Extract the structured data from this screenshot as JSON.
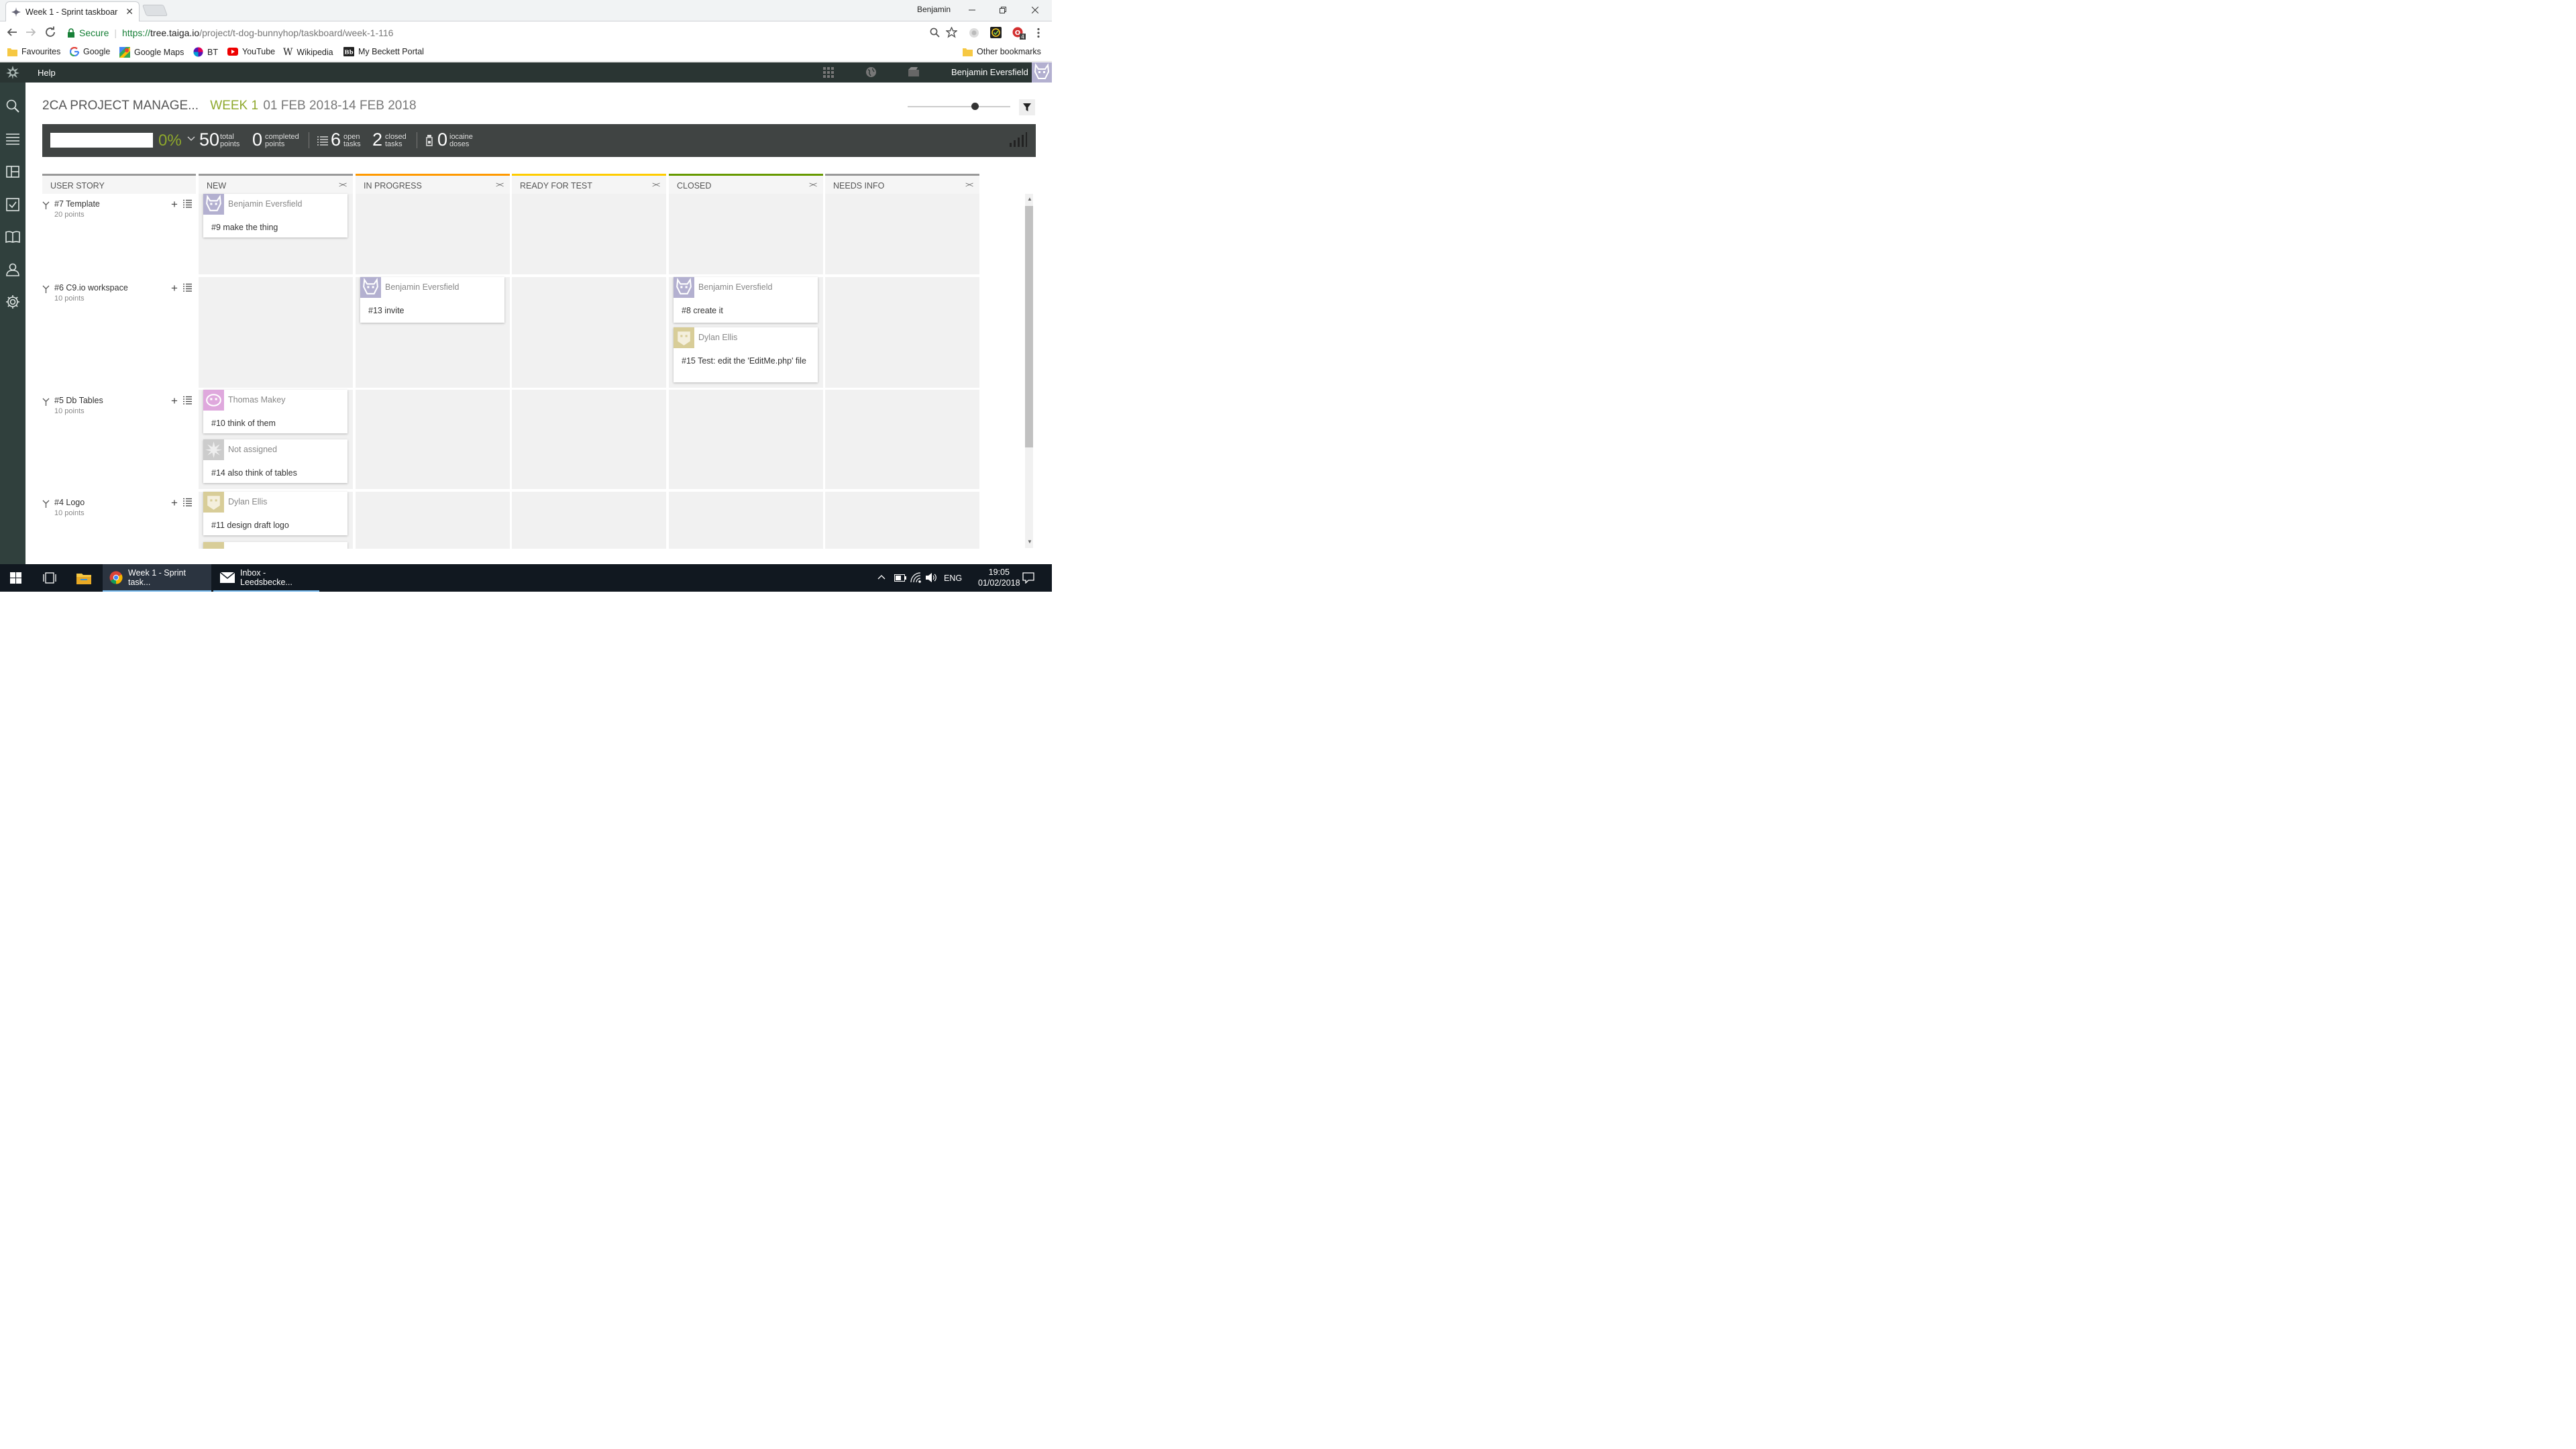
{
  "browser": {
    "tab_title": "Week 1 - Sprint taskboar",
    "profile_name": "Benjamin",
    "secure_label": "Secure",
    "url_scheme": "https://",
    "url_host": "tree.taiga.io",
    "url_path": "/project/t-dog-bunnyhop/taskboard/week-1-116"
  },
  "bookmarks": {
    "items": [
      {
        "label": "Favourites",
        "icon": "folder-icon"
      },
      {
        "label": "Google",
        "icon": "google-icon"
      },
      {
        "label": "Google Maps",
        "icon": "google-maps-icon"
      },
      {
        "label": "BT",
        "icon": "bt-icon"
      },
      {
        "label": "YouTube",
        "icon": "youtube-icon"
      },
      {
        "label": "Wikipedia",
        "icon": "wikipedia-icon"
      },
      {
        "label": "My Beckett Portal",
        "icon": "beckett-icon"
      }
    ],
    "other": "Other bookmarks"
  },
  "taiga": {
    "help_label": "Help",
    "user_name": "Benjamin Eversfield",
    "project_name": "2CA PROJECT MANAGE...",
    "sprint_name": "WEEK 1",
    "sprint_dates": "01 FEB 2018-14 FEB 2018",
    "progress_percent": "0%",
    "stats": {
      "total_points": {
        "value": "50",
        "line1": "total",
        "line2": "points"
      },
      "completed_points": {
        "value": "0",
        "line1": "completed",
        "line2": "points"
      },
      "open_tasks": {
        "value": "6",
        "line1": "open",
        "line2": "tasks"
      },
      "closed_tasks": {
        "value": "2",
        "line1": "closed",
        "line2": "tasks"
      },
      "iocaine_doses": {
        "value": "0",
        "line1": "iocaine",
        "line2": "doses"
      }
    },
    "columns": {
      "user_story": "USER STORY",
      "new": "NEW",
      "in_progress": "IN PROGRESS",
      "ready_for_test": "READY FOR TEST",
      "closed": "CLOSED",
      "needs_info": "NEEDS INFO"
    },
    "column_colors": {
      "user_story": "#999999",
      "new": "#999999",
      "in_progress": "#ff9900",
      "ready_for_test": "#ffcc00",
      "closed": "#669900",
      "needs_info": "#999999"
    },
    "stories": [
      {
        "title": "#7 Template",
        "points": "20 points"
      },
      {
        "title": "#6 C9.io workspace",
        "points": "10 points"
      },
      {
        "title": "#5 Db Tables",
        "points": "10 points"
      },
      {
        "title": "#4 Logo",
        "points": "10 points"
      }
    ],
    "tasks": {
      "t9": {
        "assignee": "Benjamin Eversfield",
        "title": "#9 make the thing"
      },
      "t13": {
        "assignee": "Benjamin Eversfield",
        "title": "#13 invite"
      },
      "t8": {
        "assignee": "Benjamin Eversfield",
        "title": "#8 create it"
      },
      "t15": {
        "assignee": "Dylan Ellis",
        "title": "#15 Test: edit the 'EditMe.php' file"
      },
      "t10": {
        "assignee": "Thomas Makey",
        "title": "#10 think of them"
      },
      "t14": {
        "assignee": "Not assigned",
        "title": "#14 also think of tables"
      },
      "t11": {
        "assignee": "Dylan Ellis",
        "title": "#11 design draft logo"
      }
    }
  },
  "taskbar": {
    "app1": "Week 1 - Sprint task...",
    "app2": "Inbox - Leedsbecke...",
    "lang": "ENG",
    "time": "19:05",
    "date": "01/02/2018"
  }
}
